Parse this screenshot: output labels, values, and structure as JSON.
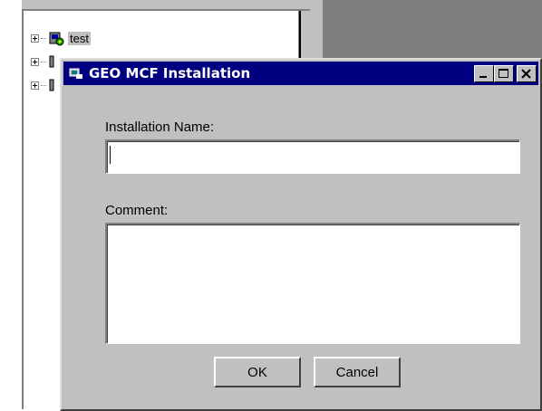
{
  "tree": {
    "items": [
      {
        "label": "test"
      }
    ]
  },
  "dialog": {
    "title": "GEO MCF Installation",
    "installation_name_label": "Installation Name:",
    "installation_name_value": "",
    "comment_label": "Comment:",
    "comment_value": "",
    "ok_label": "OK",
    "cancel_label": "Cancel"
  },
  "colors": {
    "titlebar": "#000080",
    "face": "#c0c0c0"
  }
}
